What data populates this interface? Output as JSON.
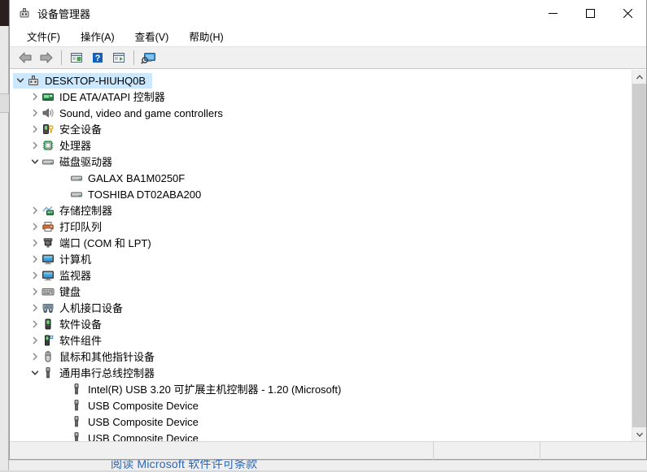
{
  "window": {
    "title": "设备管理器",
    "icon": "device-manager-icon",
    "controls": {
      "minimize_label": "最小化",
      "maximize_label": "最大化",
      "close_label": "关闭"
    }
  },
  "menubar": {
    "items": [
      {
        "label": "文件(F)",
        "name": "menu-file"
      },
      {
        "label": "操作(A)",
        "name": "menu-action"
      },
      {
        "label": "查看(V)",
        "name": "menu-view"
      },
      {
        "label": "帮助(H)",
        "name": "menu-help"
      }
    ]
  },
  "toolbar": {
    "buttons": [
      {
        "name": "back-arrow-icon",
        "title": "后退"
      },
      {
        "name": "forward-arrow-icon",
        "title": "前进"
      },
      {
        "name": "properties-icon",
        "title": "属性"
      },
      {
        "name": "help-question-icon",
        "title": "帮助"
      },
      {
        "name": "update-driver-icon",
        "title": "更新驱动程序"
      },
      {
        "name": "scan-hardware-icon",
        "title": "扫描检测硬件改动"
      }
    ]
  },
  "tree": {
    "root": {
      "label": "DESKTOP-HIUHQ0B",
      "icon": "computer-root-icon",
      "expanded": true,
      "selected": true
    },
    "nodes": [
      {
        "label": "IDE ATA/ATAPI 控制器",
        "icon": "ide-controller-icon",
        "level": 1,
        "expandable": true,
        "expanded": false
      },
      {
        "label": "Sound, video and game controllers",
        "icon": "speaker-icon",
        "level": 1,
        "expandable": true,
        "expanded": false
      },
      {
        "label": "安全设备",
        "icon": "security-device-icon",
        "level": 1,
        "expandable": true,
        "expanded": false
      },
      {
        "label": "处理器",
        "icon": "processor-icon",
        "level": 1,
        "expandable": true,
        "expanded": false
      },
      {
        "label": "磁盘驱动器",
        "icon": "disk-drive-icon",
        "level": 1,
        "expandable": true,
        "expanded": true
      },
      {
        "label": "GALAX BA1M0250F",
        "icon": "disk-drive-icon",
        "level": 2,
        "expandable": false,
        "expanded": false
      },
      {
        "label": "TOSHIBA DT02ABA200",
        "icon": "disk-drive-icon",
        "level": 2,
        "expandable": false,
        "expanded": false
      },
      {
        "label": "存储控制器",
        "icon": "storage-controller-icon",
        "level": 1,
        "expandable": true,
        "expanded": false
      },
      {
        "label": "打印队列",
        "icon": "printer-icon",
        "level": 1,
        "expandable": true,
        "expanded": false
      },
      {
        "label": "端口 (COM 和 LPT)",
        "icon": "port-icon",
        "level": 1,
        "expandable": true,
        "expanded": false
      },
      {
        "label": "计算机",
        "icon": "monitor-icon",
        "level": 1,
        "expandable": true,
        "expanded": false
      },
      {
        "label": "监视器",
        "icon": "monitor-icon",
        "level": 1,
        "expandable": true,
        "expanded": false
      },
      {
        "label": "键盘",
        "icon": "keyboard-icon",
        "level": 1,
        "expandable": true,
        "expanded": false
      },
      {
        "label": "人机接口设备",
        "icon": "hid-icon",
        "level": 1,
        "expandable": true,
        "expanded": false
      },
      {
        "label": "软件设备",
        "icon": "software-device-icon",
        "level": 1,
        "expandable": true,
        "expanded": false
      },
      {
        "label": "软件组件",
        "icon": "software-component-icon",
        "level": 1,
        "expandable": true,
        "expanded": false
      },
      {
        "label": "鼠标和其他指针设备",
        "icon": "mouse-icon",
        "level": 1,
        "expandable": true,
        "expanded": false
      },
      {
        "label": "通用串行总线控制器",
        "icon": "usb-icon",
        "level": 1,
        "expandable": true,
        "expanded": true
      },
      {
        "label": "Intel(R) USB 3.20 可扩展主机控制器 - 1.20 (Microsoft)",
        "icon": "usb-icon",
        "level": 2,
        "expandable": false,
        "expanded": false
      },
      {
        "label": "USB Composite Device",
        "icon": "usb-icon",
        "level": 2,
        "expandable": false,
        "expanded": false
      },
      {
        "label": "USB Composite Device",
        "icon": "usb-icon",
        "level": 2,
        "expandable": false,
        "expanded": false
      },
      {
        "label": "USB Composite Device",
        "icon": "usb-icon",
        "level": 2,
        "expandable": false,
        "expanded": false
      }
    ]
  },
  "statusbar": {
    "text": ""
  },
  "background": {
    "license_link": "阅读 Microsoft 软件许可条款"
  },
  "colors": {
    "selection": "#cce8ff",
    "toolbar_bg": "#f0f0f0",
    "window_bg": "#ffffff",
    "link_blue": "#2b66b5",
    "scrollbar_thumb": "#cdcdcd"
  }
}
